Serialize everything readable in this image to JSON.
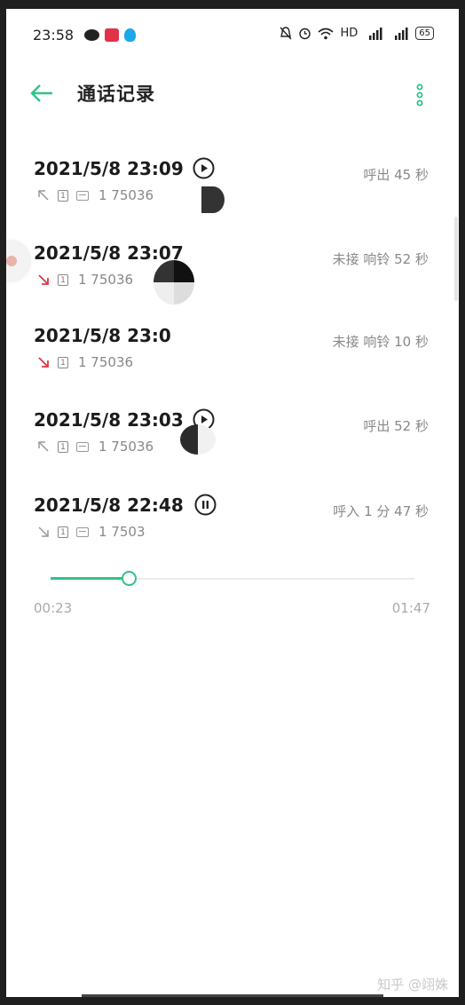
{
  "status_bar": {
    "time": "23:58",
    "network": "HD",
    "battery": "65"
  },
  "header": {
    "title": "通话记录"
  },
  "calls": [
    {
      "datetime": "2021/5/8 23:09",
      "direction": "outgoing",
      "number": "1  75036",
      "status": "呼出  45 秒",
      "has_recording": true,
      "recording_state": "play"
    },
    {
      "datetime": "2021/5/8 23:07",
      "direction": "missed",
      "number": "1  75036",
      "status": "未接  响铃 52 秒",
      "has_recording": false
    },
    {
      "datetime": "2021/5/8 23:0",
      "direction": "missed",
      "number": "1  75036",
      "status": "未接  响铃 10 秒",
      "has_recording": false
    },
    {
      "datetime": "2021/5/8 23:03",
      "direction": "outgoing",
      "number": "1  75036",
      "status": "呼出  52 秒",
      "has_recording": true,
      "recording_state": "play"
    },
    {
      "datetime": "2021/5/8 22:48",
      "direction": "incoming",
      "number": "1  7503",
      "status": "呼入  1 分 47 秒",
      "has_recording": true,
      "recording_state": "pause"
    }
  ],
  "player": {
    "current": "00:23",
    "total": "01:47",
    "progress": 0.215
  },
  "watermark": "知乎 @翊姝",
  "colors": {
    "accent": "#2fc389",
    "missed": "#d9384a"
  }
}
